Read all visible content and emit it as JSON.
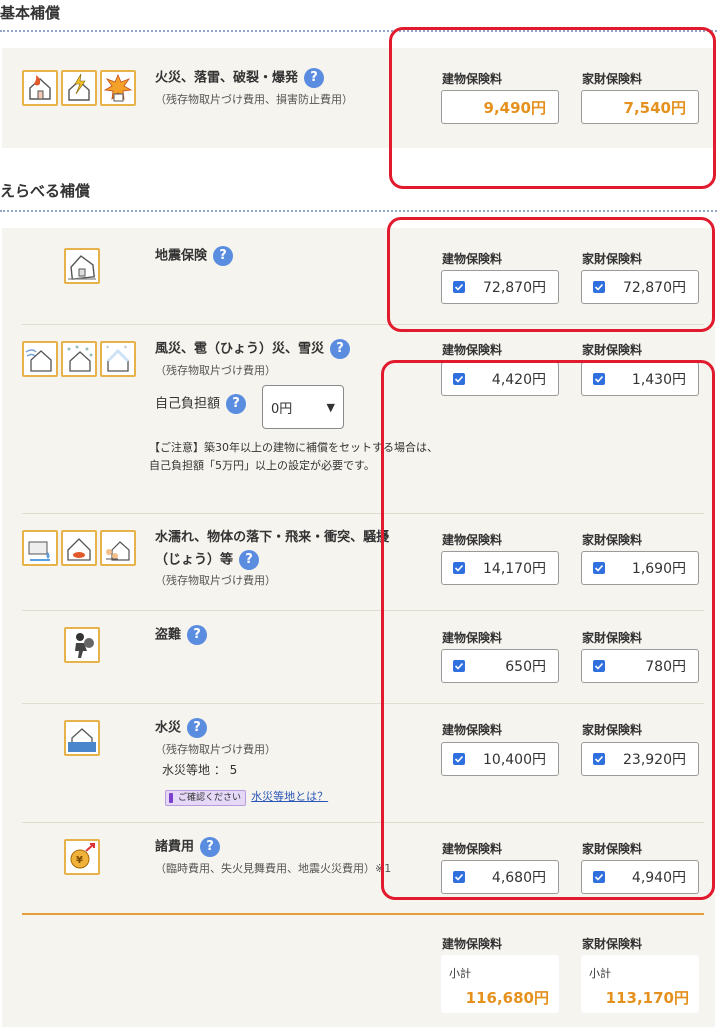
{
  "basic": {
    "title": "基本補償",
    "row": {
      "title": "火災、落雷、破裂・爆発",
      "sub": "（残存物取片づけ費用、損害防止費用）",
      "icons": [
        "fire-house-icon",
        "lightning-house-icon",
        "explosion-house-icon"
      ],
      "building_label": "建物保険料",
      "contents_label": "家財保険料",
      "building": "9,490円",
      "contents": "7,540円"
    }
  },
  "optional": {
    "title": "えらべる補償",
    "rows": [
      {
        "title": "地震保険",
        "icons": [
          "earthquake-house-icon"
        ],
        "building_label": "建物保険料",
        "contents_label": "家財保険料",
        "building": "72,870円",
        "contents": "72,870円"
      },
      {
        "title": "風災、雹（ひょう）災、雪災",
        "sub": "（残存物取片づけ費用）",
        "icons": [
          "wind-house-icon",
          "hail-house-icon",
          "snow-house-icon"
        ],
        "deductible_label": "自己負担額",
        "deductible_value": "0円",
        "note": "【ご注意】築30年以上の建物に補償をセットする場合は、自己負担額「5万円」以上の設定が必要です。",
        "building_label": "建物保険料",
        "contents_label": "家財保険料",
        "building": "4,420円",
        "contents": "1,430円"
      },
      {
        "title_line1": "水濡れ、物体の落下・飛来・衝突、騒擾",
        "title_line2": "（じょう）等",
        "sub": "（残存物取片づけ費用）",
        "icons": [
          "water-leak-icon",
          "falling-object-house-icon",
          "riot-icon"
        ],
        "building_label": "建物保険料",
        "contents_label": "家財保険料",
        "building": "14,170円",
        "contents": "1,690円"
      },
      {
        "title": "盗難",
        "icons": [
          "thief-icon"
        ],
        "building_label": "建物保険料",
        "contents_label": "家財保険料",
        "building": "650円",
        "contents": "780円"
      },
      {
        "title": "水災",
        "sub": "（残存物取片づけ費用）",
        "icons": [
          "flood-house-icon"
        ],
        "flood_level_label": "水災等地 ： 5",
        "badge": "ご確認ください",
        "link": "水災等地とは？",
        "building_label": "建物保険料",
        "contents_label": "家財保険料",
        "building": "10,400円",
        "contents": "23,920円"
      },
      {
        "title": "諸費用",
        "sub": "（臨時費用、失火見舞費用、地震火災費用）※1",
        "icons": [
          "yen-growth-icon"
        ],
        "building_label": "建物保険料",
        "contents_label": "家財保険料",
        "building": "4,680円",
        "contents": "4,940円"
      }
    ]
  },
  "subtotal": {
    "building_label": "建物保険料",
    "contents_label": "家財保険料",
    "label": "小計",
    "building": "116,680円",
    "contents": "113,170円"
  },
  "colors": {
    "accent_orange": "#e5911e",
    "highlight_red": "#e11a2d",
    "checkbox_blue": "#2f6fde",
    "help_blue": "#5a8de0",
    "panel_bg": "#f6f4ee"
  }
}
